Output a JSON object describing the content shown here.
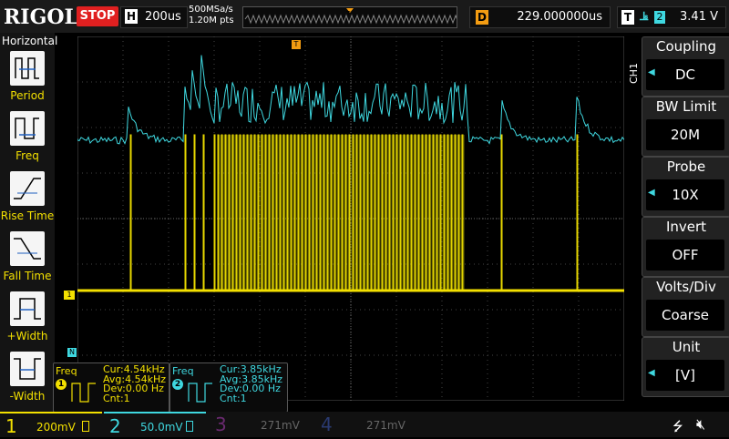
{
  "brand": "RIGOL",
  "run_state": "STOP",
  "horizontal": {
    "badge": "H",
    "timebase": "200us"
  },
  "sample": {
    "rate": "500MSa/s",
    "points": "1.20M pts"
  },
  "delay": {
    "badge": "D",
    "value": "229.000000us"
  },
  "trigger": {
    "badge": "T",
    "edge_icon": "rising-falling-edge",
    "source": "2",
    "level": "3.41 V"
  },
  "left_menu": {
    "title": "Horizontal",
    "items": [
      {
        "label": "Period",
        "icon": "period-icon"
      },
      {
        "label": "Freq",
        "icon": "freq-icon"
      },
      {
        "label": "Rise Time",
        "icon": "rise-time-icon"
      },
      {
        "label": "Fall Time",
        "icon": "fall-time-icon"
      },
      {
        "label": "+Width",
        "icon": "plus-width-icon"
      },
      {
        "label": "-Width",
        "icon": "minus-width-icon"
      }
    ]
  },
  "channel_menu": {
    "channel": "CH1",
    "items": [
      {
        "title": "Coupling",
        "value": "DC",
        "has_arrow": true
      },
      {
        "title": "BW Limit",
        "value": "20M",
        "has_arrow": false
      },
      {
        "title": "Probe",
        "value": "10X",
        "has_arrow": true
      },
      {
        "title": "Invert",
        "value": "OFF",
        "has_arrow": false
      },
      {
        "title": "Volts/Div",
        "value": "Coarse",
        "has_arrow": false
      },
      {
        "title": "Unit",
        "value": "[V]",
        "has_arrow": true
      }
    ]
  },
  "measurements": [
    {
      "type": "Freq",
      "channel": "1",
      "cur": "Cur:4.54kHz",
      "avg": "Avg:4.54kHz",
      "dev": "Dev:0.00 Hz",
      "cnt": "Cnt:1",
      "color": "#f3e000"
    },
    {
      "type": "Freq",
      "channel": "2",
      "cur": "Cur:3.85kHz",
      "avg": "Avg:3.85kHz",
      "dev": "Dev:0.00 Hz",
      "cnt": "Cnt:1",
      "color": "#3fd8e0"
    }
  ],
  "channels": [
    {
      "num": "1",
      "scale": "200mV",
      "color": "#f3e000",
      "active": true
    },
    {
      "num": "2",
      "scale": "50.0mV",
      "color": "#3fd8e0",
      "active": true
    },
    {
      "num": "3",
      "scale": "271mV",
      "color": "#c04ad0",
      "active": false
    },
    {
      "num": "4",
      "scale": "271mV",
      "color": "#3070e0",
      "active": false
    }
  ],
  "status_icons": [
    "usb-icon",
    "mute-icon"
  ],
  "colors": {
    "ch1": "#f3e000",
    "ch2": "#3fd8e0",
    "trigger_marker": "#f39c12",
    "stop": "#e02020"
  }
}
